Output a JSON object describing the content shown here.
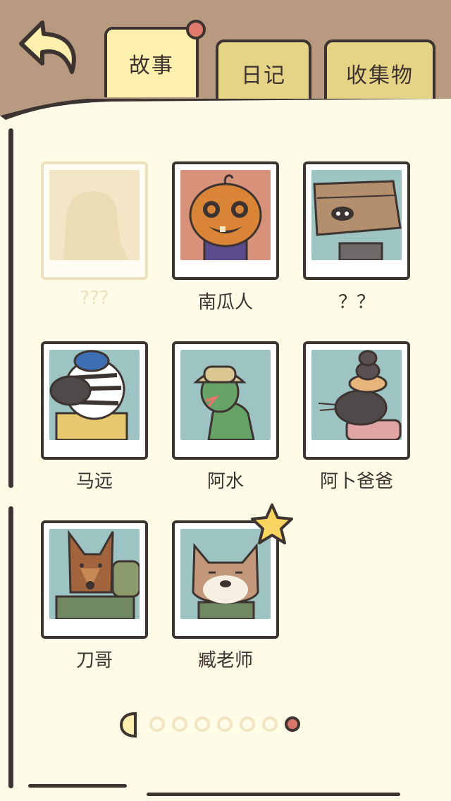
{
  "tabs": [
    {
      "label": "故事",
      "active": true,
      "has_notification": true
    },
    {
      "label": "日记",
      "active": false
    },
    {
      "label": "收集物",
      "active": false
    }
  ],
  "characters": [
    {
      "name": "???",
      "locked": true,
      "icon": "unknown-silhouette"
    },
    {
      "name": "南瓜人",
      "locked": false,
      "icon": "pumpkin-man"
    },
    {
      "name": "？？",
      "locked": false,
      "icon": "box-head"
    },
    {
      "name": "马远",
      "locked": false,
      "icon": "zebra"
    },
    {
      "name": "阿水",
      "locked": false,
      "icon": "frog-with-hat"
    },
    {
      "name": "阿卜爸爸",
      "locked": false,
      "icon": "stacked-rats"
    },
    {
      "name": "刀哥",
      "locked": false,
      "icon": "doberman"
    },
    {
      "name": "臧老师",
      "locked": false,
      "icon": "shiba-teacher",
      "starred": true
    }
  ],
  "pagination": {
    "total_pages": 7,
    "current_page": 7
  },
  "colors": {
    "background_brown": "#b79a7f",
    "page_cream": "#fefce6",
    "outline": "#3d3330",
    "tab_active": "#fdefad",
    "tab_inactive": "#e6d486",
    "notification_red": "#e07a6a",
    "star_yellow": "#f7d560"
  }
}
